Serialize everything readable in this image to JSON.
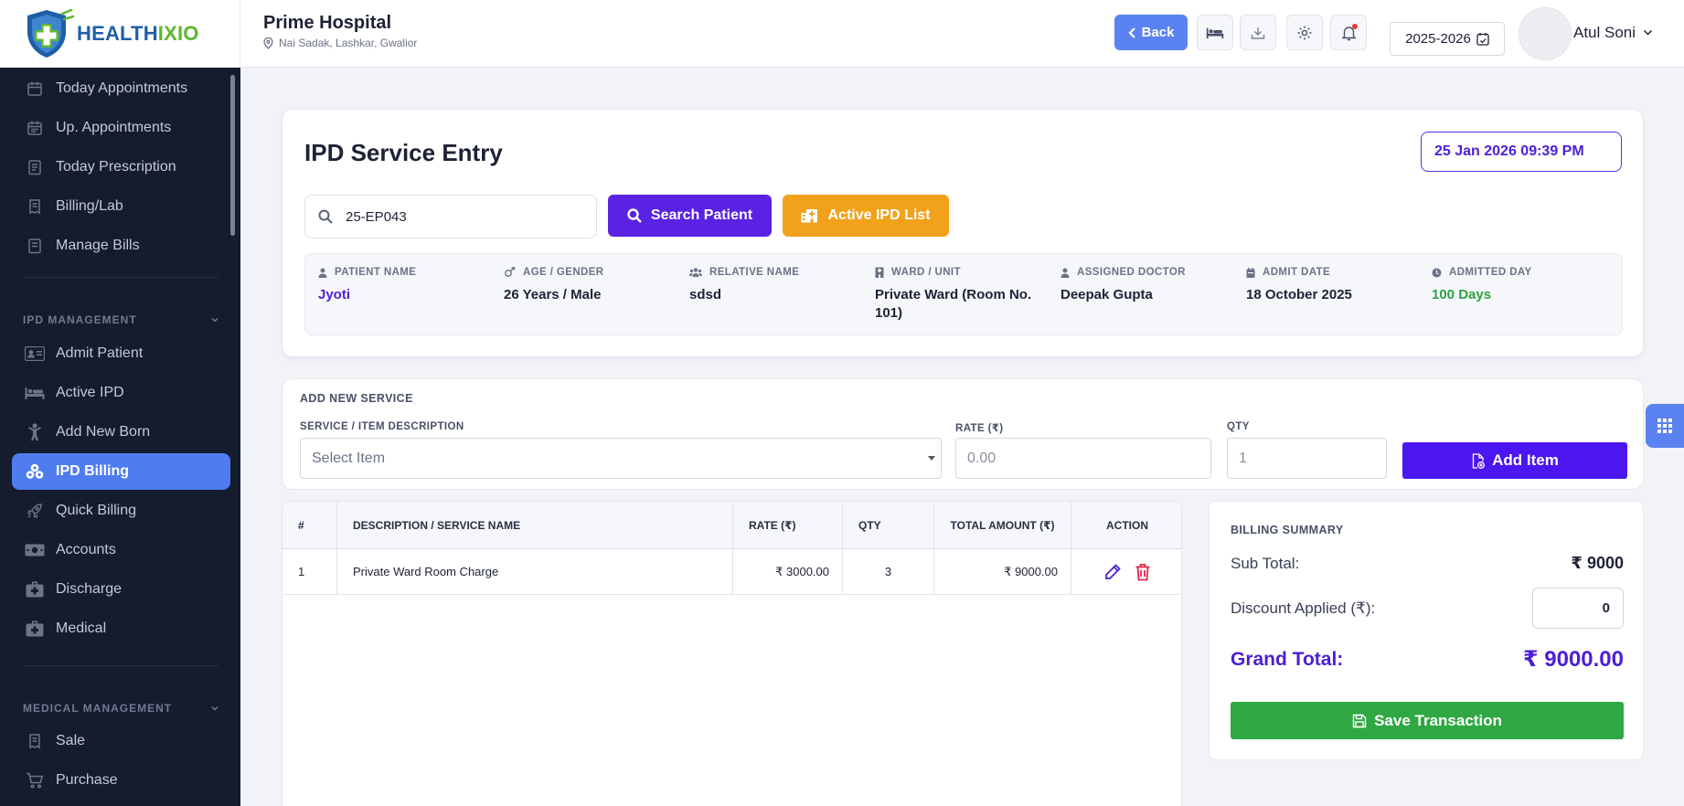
{
  "brand": {
    "part1": "HEALTH",
    "part2": "IXIO"
  },
  "sidebar": {
    "items": [
      {
        "label": "Today Appointments",
        "icon": "calendar-icon"
      },
      {
        "label": "Up. Appointments",
        "icon": "calendar-list-icon"
      },
      {
        "label": "Today Prescription",
        "icon": "prescription-icon"
      },
      {
        "label": "Billing/Lab",
        "icon": "invoice-icon"
      },
      {
        "label": "Manage Bills",
        "icon": "bill-icon"
      },
      {
        "label": "Admit Patient",
        "icon": "id-card-icon"
      },
      {
        "label": "Active IPD",
        "icon": "bed-icon"
      },
      {
        "label": "Add New Born",
        "icon": "child-icon"
      },
      {
        "label": "IPD Billing",
        "icon": "coins-icon"
      },
      {
        "label": "Quick Billing",
        "icon": "rocket-icon"
      },
      {
        "label": "Accounts",
        "icon": "money-icon"
      },
      {
        "label": "Discharge",
        "icon": "medkit-icon"
      },
      {
        "label": "Medical",
        "icon": "medkit-icon"
      },
      {
        "label": "Sale",
        "icon": "receipt-icon"
      },
      {
        "label": "Purchase",
        "icon": "cart-icon"
      }
    ],
    "sections": {
      "ipd": "IPD MANAGEMENT",
      "medical": "MEDICAL MANAGEMENT"
    },
    "active": "IPD Billing"
  },
  "header": {
    "hospital_name": "Prime Hospital",
    "address": "Nai Sadak, Lashkar, Gwalior",
    "back_label": "Back",
    "year": "2025-2026",
    "user_name": "Atul Soni"
  },
  "entry": {
    "title": "IPD Service Entry",
    "datetime": "25 Jan 2026 09:39 PM",
    "search_value": "25-EP043",
    "search_button": "Search Patient",
    "active_ipd_button": "Active IPD List"
  },
  "patient": {
    "name_label": "PATIENT NAME",
    "name": "Jyoti",
    "age_label": "AGE / GENDER",
    "age": "26 Years / Male",
    "relative_label": "RELATIVE NAME",
    "relative": "sdsd",
    "ward_label": "WARD / UNIT",
    "ward": "Private Ward (Room No. 101)",
    "doctor_label": "ASSIGNED DOCTOR",
    "doctor": "Deepak Gupta",
    "admit_label": "ADMIT DATE",
    "admit": "18 October 2025",
    "days_label": "ADMITTED DAY",
    "days": "100 Days"
  },
  "add_service": {
    "title": "ADD NEW SERVICE",
    "item_label": "SERVICE / ITEM DESCRIPTION",
    "item_placeholder": "Select Item",
    "rate_label": "RATE (₹)",
    "rate_placeholder": "0.00",
    "qty_label": "QTY",
    "qty_placeholder": "1",
    "add_button": "Add Item"
  },
  "table": {
    "headers": [
      "#",
      "DESCRIPTION / SERVICE NAME",
      "RATE (₹)",
      "QTY",
      "TOTAL AMOUNT (₹)",
      "ACTION"
    ],
    "rows": [
      {
        "no": "1",
        "desc": "Private Ward Room Charge",
        "rate": "₹ 3000.00",
        "qty": "3",
        "total": "₹ 9000.00"
      }
    ]
  },
  "summary": {
    "title": "BILLING SUMMARY",
    "subtotal_label": "Sub Total:",
    "subtotal": "₹ 9000",
    "discount_label": "Discount Applied (₹):",
    "discount": "0",
    "grand_label": "Grand Total:",
    "grand": "₹ 9000.00",
    "save_button": "Save Transaction"
  },
  "colors": {
    "accent": "#4b1fd6",
    "active_nav": "#4f7df0",
    "warning": "#f1a21a",
    "success": "#2fa843",
    "danger": "#e0284a"
  }
}
